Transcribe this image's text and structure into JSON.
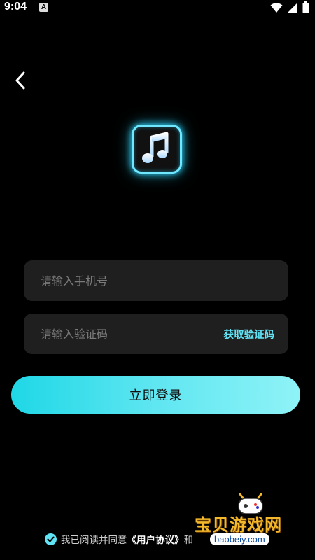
{
  "status_bar": {
    "time": "9:04",
    "notification_icon_letter": "A",
    "icons": [
      "wifi-icon",
      "signal-icon",
      "battery-icon"
    ]
  },
  "header": {
    "back_icon": "chevron-left-icon"
  },
  "logo": {
    "icon": "music-note-icon",
    "accent_color": "#2fd7ff"
  },
  "form": {
    "phone_placeholder": "请输入手机号",
    "phone_value": "",
    "code_placeholder": "请输入验证码",
    "code_value": "",
    "get_code_label": "获取验证码",
    "login_label": "立即登录"
  },
  "agreement": {
    "checked": true,
    "prefix": "我已阅读并同意",
    "user_agreement": "《用户协议》",
    "connector": "和"
  },
  "watermark": {
    "title": "宝贝游戏网",
    "domain": "baobeiy.com"
  },
  "colors": {
    "background": "#000000",
    "accent": "#5fe3f5",
    "input_background": "#1f1f1f"
  }
}
